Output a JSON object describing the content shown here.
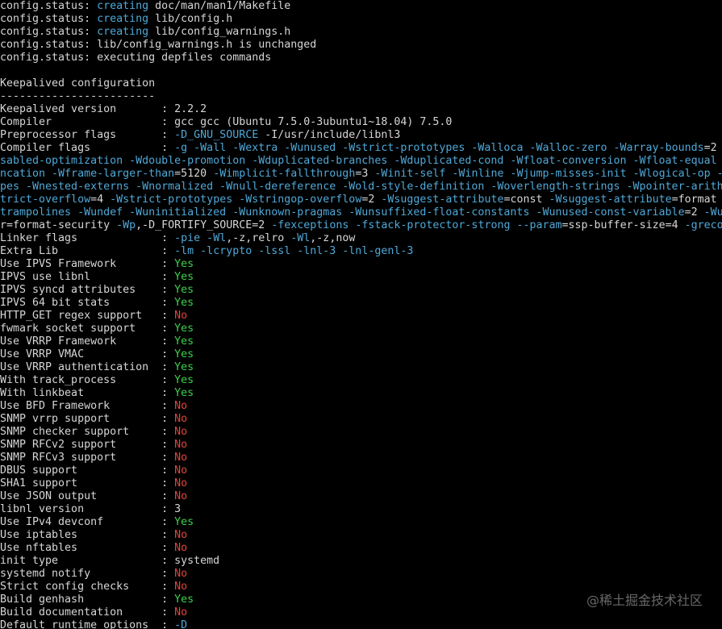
{
  "colors": {
    "background": "#000000",
    "text": "#d6d6d6",
    "blue": "#4fa8d8",
    "yes": "#3cd04a",
    "no": "#e0463c"
  },
  "lines": [
    {
      "segments": [
        {
          "text": "config.status: "
        },
        {
          "text": "creating",
          "color": "blue"
        },
        {
          "text": " doc/man/man1/Makefile"
        }
      ]
    },
    {
      "segments": [
        {
          "text": "config.status: "
        },
        {
          "text": "creating",
          "color": "blue"
        },
        {
          "text": " lib/config.h"
        }
      ]
    },
    {
      "segments": [
        {
          "text": "config.status: "
        },
        {
          "text": "creating",
          "color": "blue"
        },
        {
          "text": " lib/config_warnings.h"
        }
      ]
    },
    {
      "segments": [
        {
          "text": "config.status: lib/config_warnings.h is unchanged"
        }
      ]
    },
    {
      "segments": [
        {
          "text": "config.status: executing depfiles commands"
        }
      ]
    },
    {
      "segments": [
        {
          "text": ""
        }
      ]
    },
    {
      "segments": [
        {
          "text": "Keepalived configuration"
        }
      ]
    },
    {
      "segments": [
        {
          "text": "------------------------"
        }
      ]
    },
    {
      "segments": [
        {
          "text": "Keepalived version       : 2.2.2"
        }
      ]
    },
    {
      "segments": [
        {
          "text": "Compiler                 : gcc gcc (Ubuntu 7.5.0-3ubuntu1~18.04) 7.5.0"
        }
      ]
    },
    {
      "segments": [
        {
          "text": "Preprocessor flags       : "
        },
        {
          "text": "-D_GNU_SOURCE",
          "color": "blue"
        },
        {
          "text": " -I/usr/include/libnl3"
        }
      ]
    },
    {
      "segments": [
        {
          "text": "Compiler flags           : "
        },
        {
          "text": "-g -Wall -Wextra -Wunused -Wstrict-prototypes -Walloca -Walloc-zero -Warray-bounds",
          "color": "blue"
        },
        {
          "text": "=2"
        }
      ]
    },
    {
      "segments": [
        {
          "text": "sabled-optimization -Wdouble-promotion -Wduplicated-branches -Wduplicated-cond -Wfloat-conversion -Wfloat-equal",
          "color": "blue"
        }
      ]
    },
    {
      "segments": [
        {
          "text": "ncation -Wframe-larger-than",
          "color": "blue"
        },
        {
          "text": "=5120 "
        },
        {
          "text": "-Wimplicit-fallthrough",
          "color": "blue"
        },
        {
          "text": "=3 "
        },
        {
          "text": "-Winit-self -Winline -Wjump-misses-init -Wlogical-op -",
          "color": "blue"
        }
      ]
    },
    {
      "segments": [
        {
          "text": "pes -Wnested-externs -Wnormalized -Wnull-dereference -Wold-style-definition -Woverlength-strings -Wpointer-arith",
          "color": "blue"
        }
      ]
    },
    {
      "segments": [
        {
          "text": "trict-overflow",
          "color": "blue"
        },
        {
          "text": "=4 "
        },
        {
          "text": "-Wstrict-prototypes -Wstringop-overflow",
          "color": "blue"
        },
        {
          "text": "=2 "
        },
        {
          "text": "-Wsuggest-attribute",
          "color": "blue"
        },
        {
          "text": "=const "
        },
        {
          "text": "-Wsuggest-attribute",
          "color": "blue"
        },
        {
          "text": "=format"
        }
      ]
    },
    {
      "segments": [
        {
          "text": "trampolines -Wundef -Wuninitialized -Wunknown-pragmas -Wunsuffixed-float-constants -Wunused-const-variable",
          "color": "blue"
        },
        {
          "text": "=2 "
        },
        {
          "text": "-Wu",
          "color": "blue"
        }
      ]
    },
    {
      "segments": [
        {
          "text": "r=format-security "
        },
        {
          "text": "-Wp",
          "color": "blue"
        },
        {
          "text": ",-D_FORTIFY_SOURCE=2 "
        },
        {
          "text": "-fexceptions -fstack-protector-strong --param",
          "color": "blue"
        },
        {
          "text": "=ssp-buffer-size=4 "
        },
        {
          "text": "-greco",
          "color": "blue"
        }
      ]
    },
    {
      "segments": [
        {
          "text": "Linker flags             : "
        },
        {
          "text": "-pie -Wl",
          "color": "blue"
        },
        {
          "text": ",-z,relro "
        },
        {
          "text": "-Wl",
          "color": "blue"
        },
        {
          "text": ",-z,now"
        }
      ]
    },
    {
      "segments": [
        {
          "text": "Extra Lib                : "
        },
        {
          "text": "-lm -lcrypto -lssl -lnl-3 -lnl-genl-3",
          "color": "blue"
        }
      ]
    },
    {
      "segments": [
        {
          "text": "Use IPVS Framework       : "
        },
        {
          "text": "Yes",
          "color": "green"
        }
      ]
    },
    {
      "segments": [
        {
          "text": "IPVS use libnl           : "
        },
        {
          "text": "Yes",
          "color": "green"
        }
      ]
    },
    {
      "segments": [
        {
          "text": "IPVS syncd attributes    : "
        },
        {
          "text": "Yes",
          "color": "green"
        }
      ]
    },
    {
      "segments": [
        {
          "text": "IPVS 64 bit stats        : "
        },
        {
          "text": "Yes",
          "color": "green"
        }
      ]
    },
    {
      "segments": [
        {
          "text": "HTTP_GET regex support   : "
        },
        {
          "text": "No",
          "color": "red"
        }
      ]
    },
    {
      "segments": [
        {
          "text": "fwmark socket support    : "
        },
        {
          "text": "Yes",
          "color": "green"
        }
      ]
    },
    {
      "segments": [
        {
          "text": "Use VRRP Framework       : "
        },
        {
          "text": "Yes",
          "color": "green"
        }
      ]
    },
    {
      "segments": [
        {
          "text": "Use VRRP VMAC            : "
        },
        {
          "text": "Yes",
          "color": "green"
        }
      ]
    },
    {
      "segments": [
        {
          "text": "Use VRRP authentication  : "
        },
        {
          "text": "Yes",
          "color": "green"
        }
      ]
    },
    {
      "segments": [
        {
          "text": "With track_process       : "
        },
        {
          "text": "Yes",
          "color": "green"
        }
      ]
    },
    {
      "segments": [
        {
          "text": "With linkbeat            : "
        },
        {
          "text": "Yes",
          "color": "green"
        }
      ]
    },
    {
      "segments": [
        {
          "text": "Use BFD Framework        : "
        },
        {
          "text": "No",
          "color": "red"
        }
      ]
    },
    {
      "segments": [
        {
          "text": "SNMP vrrp support        : "
        },
        {
          "text": "No",
          "color": "red"
        }
      ]
    },
    {
      "segments": [
        {
          "text": "SNMP checker support     : "
        },
        {
          "text": "No",
          "color": "red"
        }
      ]
    },
    {
      "segments": [
        {
          "text": "SNMP RFCv2 support       : "
        },
        {
          "text": "No",
          "color": "red"
        }
      ]
    },
    {
      "segments": [
        {
          "text": "SNMP RFCv3 support       : "
        },
        {
          "text": "No",
          "color": "red"
        }
      ]
    },
    {
      "segments": [
        {
          "text": "DBUS support             : "
        },
        {
          "text": "No",
          "color": "red"
        }
      ]
    },
    {
      "segments": [
        {
          "text": "SHA1 support             : "
        },
        {
          "text": "No",
          "color": "red"
        }
      ]
    },
    {
      "segments": [
        {
          "text": "Use JSON output          : "
        },
        {
          "text": "No",
          "color": "red"
        }
      ]
    },
    {
      "segments": [
        {
          "text": "libnl version            : 3"
        }
      ]
    },
    {
      "segments": [
        {
          "text": "Use IPv4 devconf         : "
        },
        {
          "text": "Yes",
          "color": "green"
        }
      ]
    },
    {
      "segments": [
        {
          "text": "Use iptables             : "
        },
        {
          "text": "No",
          "color": "red"
        }
      ]
    },
    {
      "segments": [
        {
          "text": "Use nftables             : "
        },
        {
          "text": "No",
          "color": "red"
        }
      ]
    },
    {
      "segments": [
        {
          "text": "init type                : systemd"
        }
      ]
    },
    {
      "segments": [
        {
          "text": "systemd notify           : "
        },
        {
          "text": "No",
          "color": "red"
        }
      ]
    },
    {
      "segments": [
        {
          "text": "Strict config checks     : "
        },
        {
          "text": "No",
          "color": "red"
        }
      ]
    },
    {
      "segments": [
        {
          "text": "Build genhash            : "
        },
        {
          "text": "Yes",
          "color": "green"
        }
      ]
    },
    {
      "segments": [
        {
          "text": "Build documentation      : "
        },
        {
          "text": "No",
          "color": "red"
        }
      ]
    },
    {
      "segments": [
        {
          "text": "Default runtime options  : "
        },
        {
          "text": "-D",
          "color": "blue"
        }
      ]
    }
  ],
  "watermark": "@稀土掘金技术社区"
}
